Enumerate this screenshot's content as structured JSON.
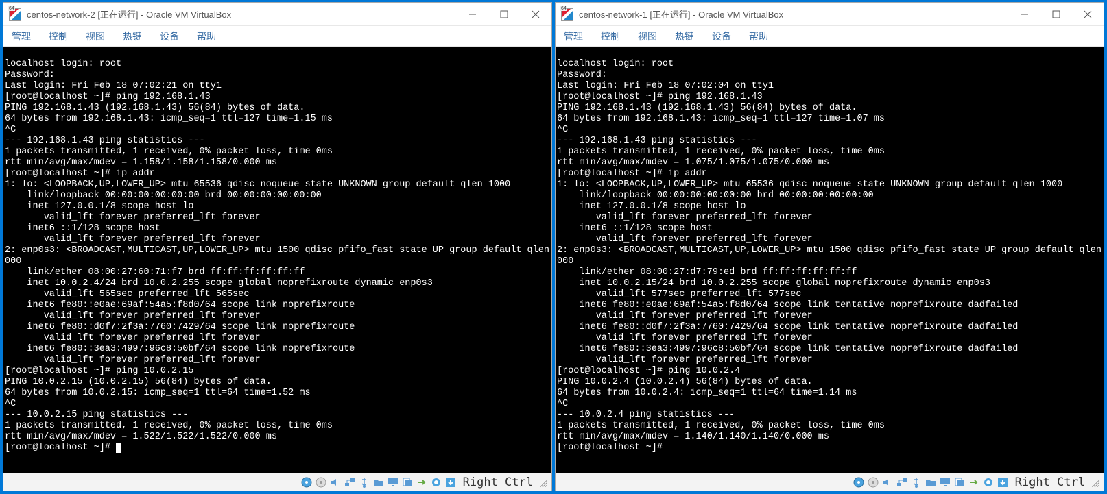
{
  "menus": [
    "管理",
    "控制",
    "视图",
    "热键",
    "设备",
    "帮助"
  ],
  "host_key": "Right Ctrl",
  "tray_icons": [
    "hdd-icon",
    "optical-icon",
    "audio-icon",
    "network-icon",
    "usb-icon",
    "shared-folder-icon",
    "display-icon",
    "clipboard-icon",
    "drag-drop-icon",
    "recording-icon",
    "host-key-arrow-icon"
  ],
  "windows": [
    {
      "title": "centos-network-2 [正在运行] - Oracle VM VirtualBox",
      "has_cursor": true,
      "terminal_lines": [
        "",
        "localhost login: root",
        "Password:",
        "Last login: Fri Feb 18 07:02:21 on tty1",
        "[root@localhost ~]# ping 192.168.1.43",
        "PING 192.168.1.43 (192.168.1.43) 56(84) bytes of data.",
        "64 bytes from 192.168.1.43: icmp_seq=1 ttl=127 time=1.15 ms",
        "^C",
        "--- 192.168.1.43 ping statistics ---",
        "1 packets transmitted, 1 received, 0% packet loss, time 0ms",
        "rtt min/avg/max/mdev = 1.158/1.158/1.158/0.000 ms",
        "[root@localhost ~]# ip addr",
        "1: lo: <LOOPBACK,UP,LOWER_UP> mtu 65536 qdisc noqueue state UNKNOWN group default qlen 1000",
        "    link/loopback 00:00:00:00:00:00 brd 00:00:00:00:00:00",
        "    inet 127.0.0.1/8 scope host lo",
        "       valid_lft forever preferred_lft forever",
        "    inet6 ::1/128 scope host",
        "       valid_lft forever preferred_lft forever",
        "2: enp0s3: <BROADCAST,MULTICAST,UP,LOWER_UP> mtu 1500 qdisc pfifo_fast state UP group default qlen 1",
        "000",
        "    link/ether 08:00:27:60:71:f7 brd ff:ff:ff:ff:ff:ff",
        "    inet 10.0.2.4/24 brd 10.0.2.255 scope global noprefixroute dynamic enp0s3",
        "       valid_lft 565sec preferred_lft 565sec",
        "    inet6 fe80::e0ae:69af:54a5:f8d0/64 scope link noprefixroute",
        "       valid_lft forever preferred_lft forever",
        "    inet6 fe80::d0f7:2f3a:7760:7429/64 scope link noprefixroute",
        "       valid_lft forever preferred_lft forever",
        "    inet6 fe80::3ea3:4997:96c8:50bf/64 scope link noprefixroute",
        "       valid_lft forever preferred_lft forever",
        "[root@localhost ~]# ping 10.0.2.15",
        "PING 10.0.2.15 (10.0.2.15) 56(84) bytes of data.",
        "64 bytes from 10.0.2.15: icmp_seq=1 ttl=64 time=1.52 ms",
        "^C",
        "--- 10.0.2.15 ping statistics ---",
        "1 packets transmitted, 1 received, 0% packet loss, time 0ms",
        "rtt min/avg/max/mdev = 1.522/1.522/1.522/0.000 ms",
        "[root@localhost ~]# "
      ]
    },
    {
      "title": "centos-network-1 [正在运行] - Oracle VM VirtualBox",
      "has_cursor": false,
      "terminal_lines": [
        "",
        "localhost login: root",
        "Password:",
        "Last login: Fri Feb 18 07:02:04 on tty1",
        "[root@localhost ~]# ping 192.168.1.43",
        "PING 192.168.1.43 (192.168.1.43) 56(84) bytes of data.",
        "64 bytes from 192.168.1.43: icmp_seq=1 ttl=127 time=1.07 ms",
        "^C",
        "--- 192.168.1.43 ping statistics ---",
        "1 packets transmitted, 1 received, 0% packet loss, time 0ms",
        "rtt min/avg/max/mdev = 1.075/1.075/1.075/0.000 ms",
        "[root@localhost ~]# ip addr",
        "1: lo: <LOOPBACK,UP,LOWER_UP> mtu 65536 qdisc noqueue state UNKNOWN group default qlen 1000",
        "    link/loopback 00:00:00:00:00:00 brd 00:00:00:00:00:00",
        "    inet 127.0.0.1/8 scope host lo",
        "       valid_lft forever preferred_lft forever",
        "    inet6 ::1/128 scope host",
        "       valid_lft forever preferred_lft forever",
        "2: enp0s3: <BROADCAST,MULTICAST,UP,LOWER_UP> mtu 1500 qdisc pfifo_fast state UP group default qlen 1",
        "000",
        "    link/ether 08:00:27:d7:79:ed brd ff:ff:ff:ff:ff:ff",
        "    inet 10.0.2.15/24 brd 10.0.2.255 scope global noprefixroute dynamic enp0s3",
        "       valid_lft 577sec preferred_lft 577sec",
        "    inet6 fe80::e0ae:69af:54a5:f8d0/64 scope link tentative noprefixroute dadfailed",
        "       valid_lft forever preferred_lft forever",
        "    inet6 fe80::d0f7:2f3a:7760:7429/64 scope link tentative noprefixroute dadfailed",
        "       valid_lft forever preferred_lft forever",
        "    inet6 fe80::3ea3:4997:96c8:50bf/64 scope link tentative noprefixroute dadfailed",
        "       valid_lft forever preferred_lft forever",
        "[root@localhost ~]# ping 10.0.2.4",
        "PING 10.0.2.4 (10.0.2.4) 56(84) bytes of data.",
        "64 bytes from 10.0.2.4: icmp_seq=1 ttl=64 time=1.14 ms",
        "^C",
        "--- 10.0.2.4 ping statistics ---",
        "1 packets transmitted, 1 received, 0% packet loss, time 0ms",
        "rtt min/avg/max/mdev = 1.140/1.140/1.140/0.000 ms",
        "[root@localhost ~]#"
      ]
    }
  ]
}
